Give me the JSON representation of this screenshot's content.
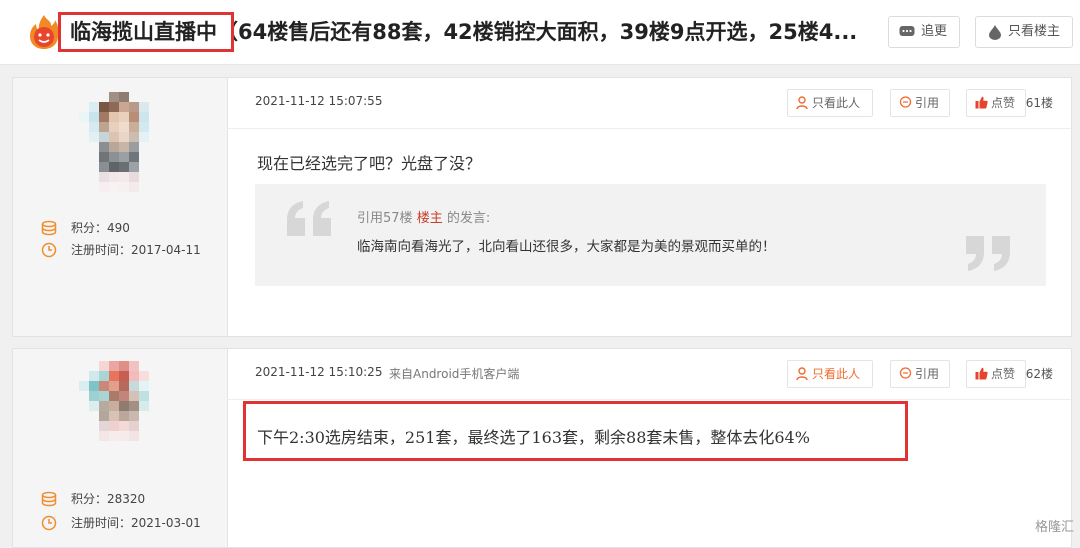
{
  "header": {
    "title": "临海揽山直播中（64楼售后还有88套，42楼销控大面积，39楼9点开选，25楼4...",
    "follow_label": "追更",
    "only_op_label": "只看楼主"
  },
  "posts": [
    {
      "user": {
        "points_label": "积分：490",
        "register_label": "注册时间：2017-04-11"
      },
      "date": "2021-11-12 15:07:55",
      "source": "",
      "actions": {
        "only_this": "只看此人",
        "quote": "引用",
        "like": "点赞"
      },
      "floor": "61楼",
      "content": "现在已经选完了吧？光盘了没？",
      "quote": {
        "cite_prefix": "引用57楼",
        "author": "楼主",
        "cite_suffix": "的发言:",
        "text": "临海南向看海光了，北向看山还很多，大家都是为美的景观而买单的！"
      }
    },
    {
      "user": {
        "points_label": "积分：28320",
        "register_label": "注册时间：2021-03-01"
      },
      "date": "2021-11-12 15:10:25",
      "source": "来自Android手机客户端",
      "actions": {
        "only_this": "只看此人",
        "quote": "引用",
        "like": "点赞"
      },
      "floor": "62楼",
      "content": "下午2:30选房结束，251套，最终选了163套，剩余88套未售，整体去化64%"
    }
  ],
  "watermark": "格隆汇",
  "colors": {
    "highlight_red": "#e03333",
    "accent_orange": "#ef6b2f",
    "author_red": "#c8402c",
    "like_red": "#e5432d"
  }
}
